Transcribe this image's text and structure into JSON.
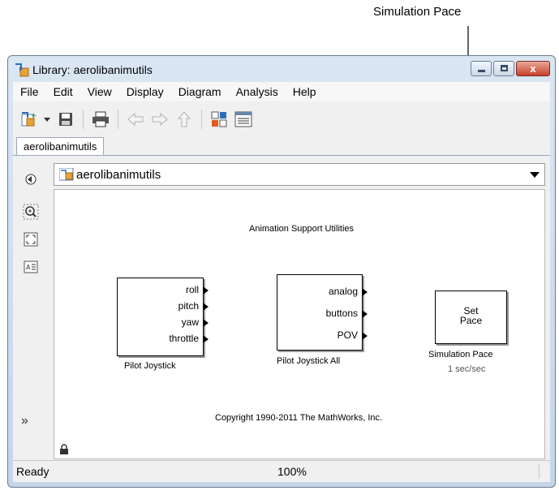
{
  "callout": {
    "label": "Simulation Pace"
  },
  "window": {
    "title": "Library: aerolibanimutils",
    "controls": [
      "minimize",
      "maximize",
      "close"
    ],
    "close_glyph": "x"
  },
  "menubar": {
    "items": [
      "File",
      "Edit",
      "View",
      "Display",
      "Diagram",
      "Analysis",
      "Help"
    ]
  },
  "toolbar": {
    "icons": [
      "new-model-icon",
      "dropdown-icon",
      "save-icon",
      "print-icon",
      "back-icon",
      "forward-icon",
      "up-icon",
      "library-browser-icon",
      "model-explorer-icon"
    ]
  },
  "tabs": [
    {
      "label": "aerolibanimutils",
      "active": true
    }
  ],
  "address": {
    "path": "aerolibanimutils"
  },
  "canvas": {
    "title": "Animation Support Utilities",
    "copyright": "Copyright 1990-2011 The MathWorks, Inc.",
    "blocks": [
      {
        "name": "Pilot Joystick",
        "ports": [
          "roll",
          "pitch",
          "yaw",
          "throttle"
        ]
      },
      {
        "name": "Pilot Joystick All",
        "ports": [
          "analog",
          "buttons",
          "POV"
        ]
      },
      {
        "name": "Simulation Pace",
        "content_line1": "Set",
        "content_line2": "Pace",
        "param": "1 sec/sec"
      }
    ]
  },
  "statusbar": {
    "status": "Ready",
    "zoom": "100%"
  },
  "colors": {
    "window_frame": "#c5d6ea",
    "close_button": "#c7402a",
    "canvas_bg": "#ffffff"
  }
}
